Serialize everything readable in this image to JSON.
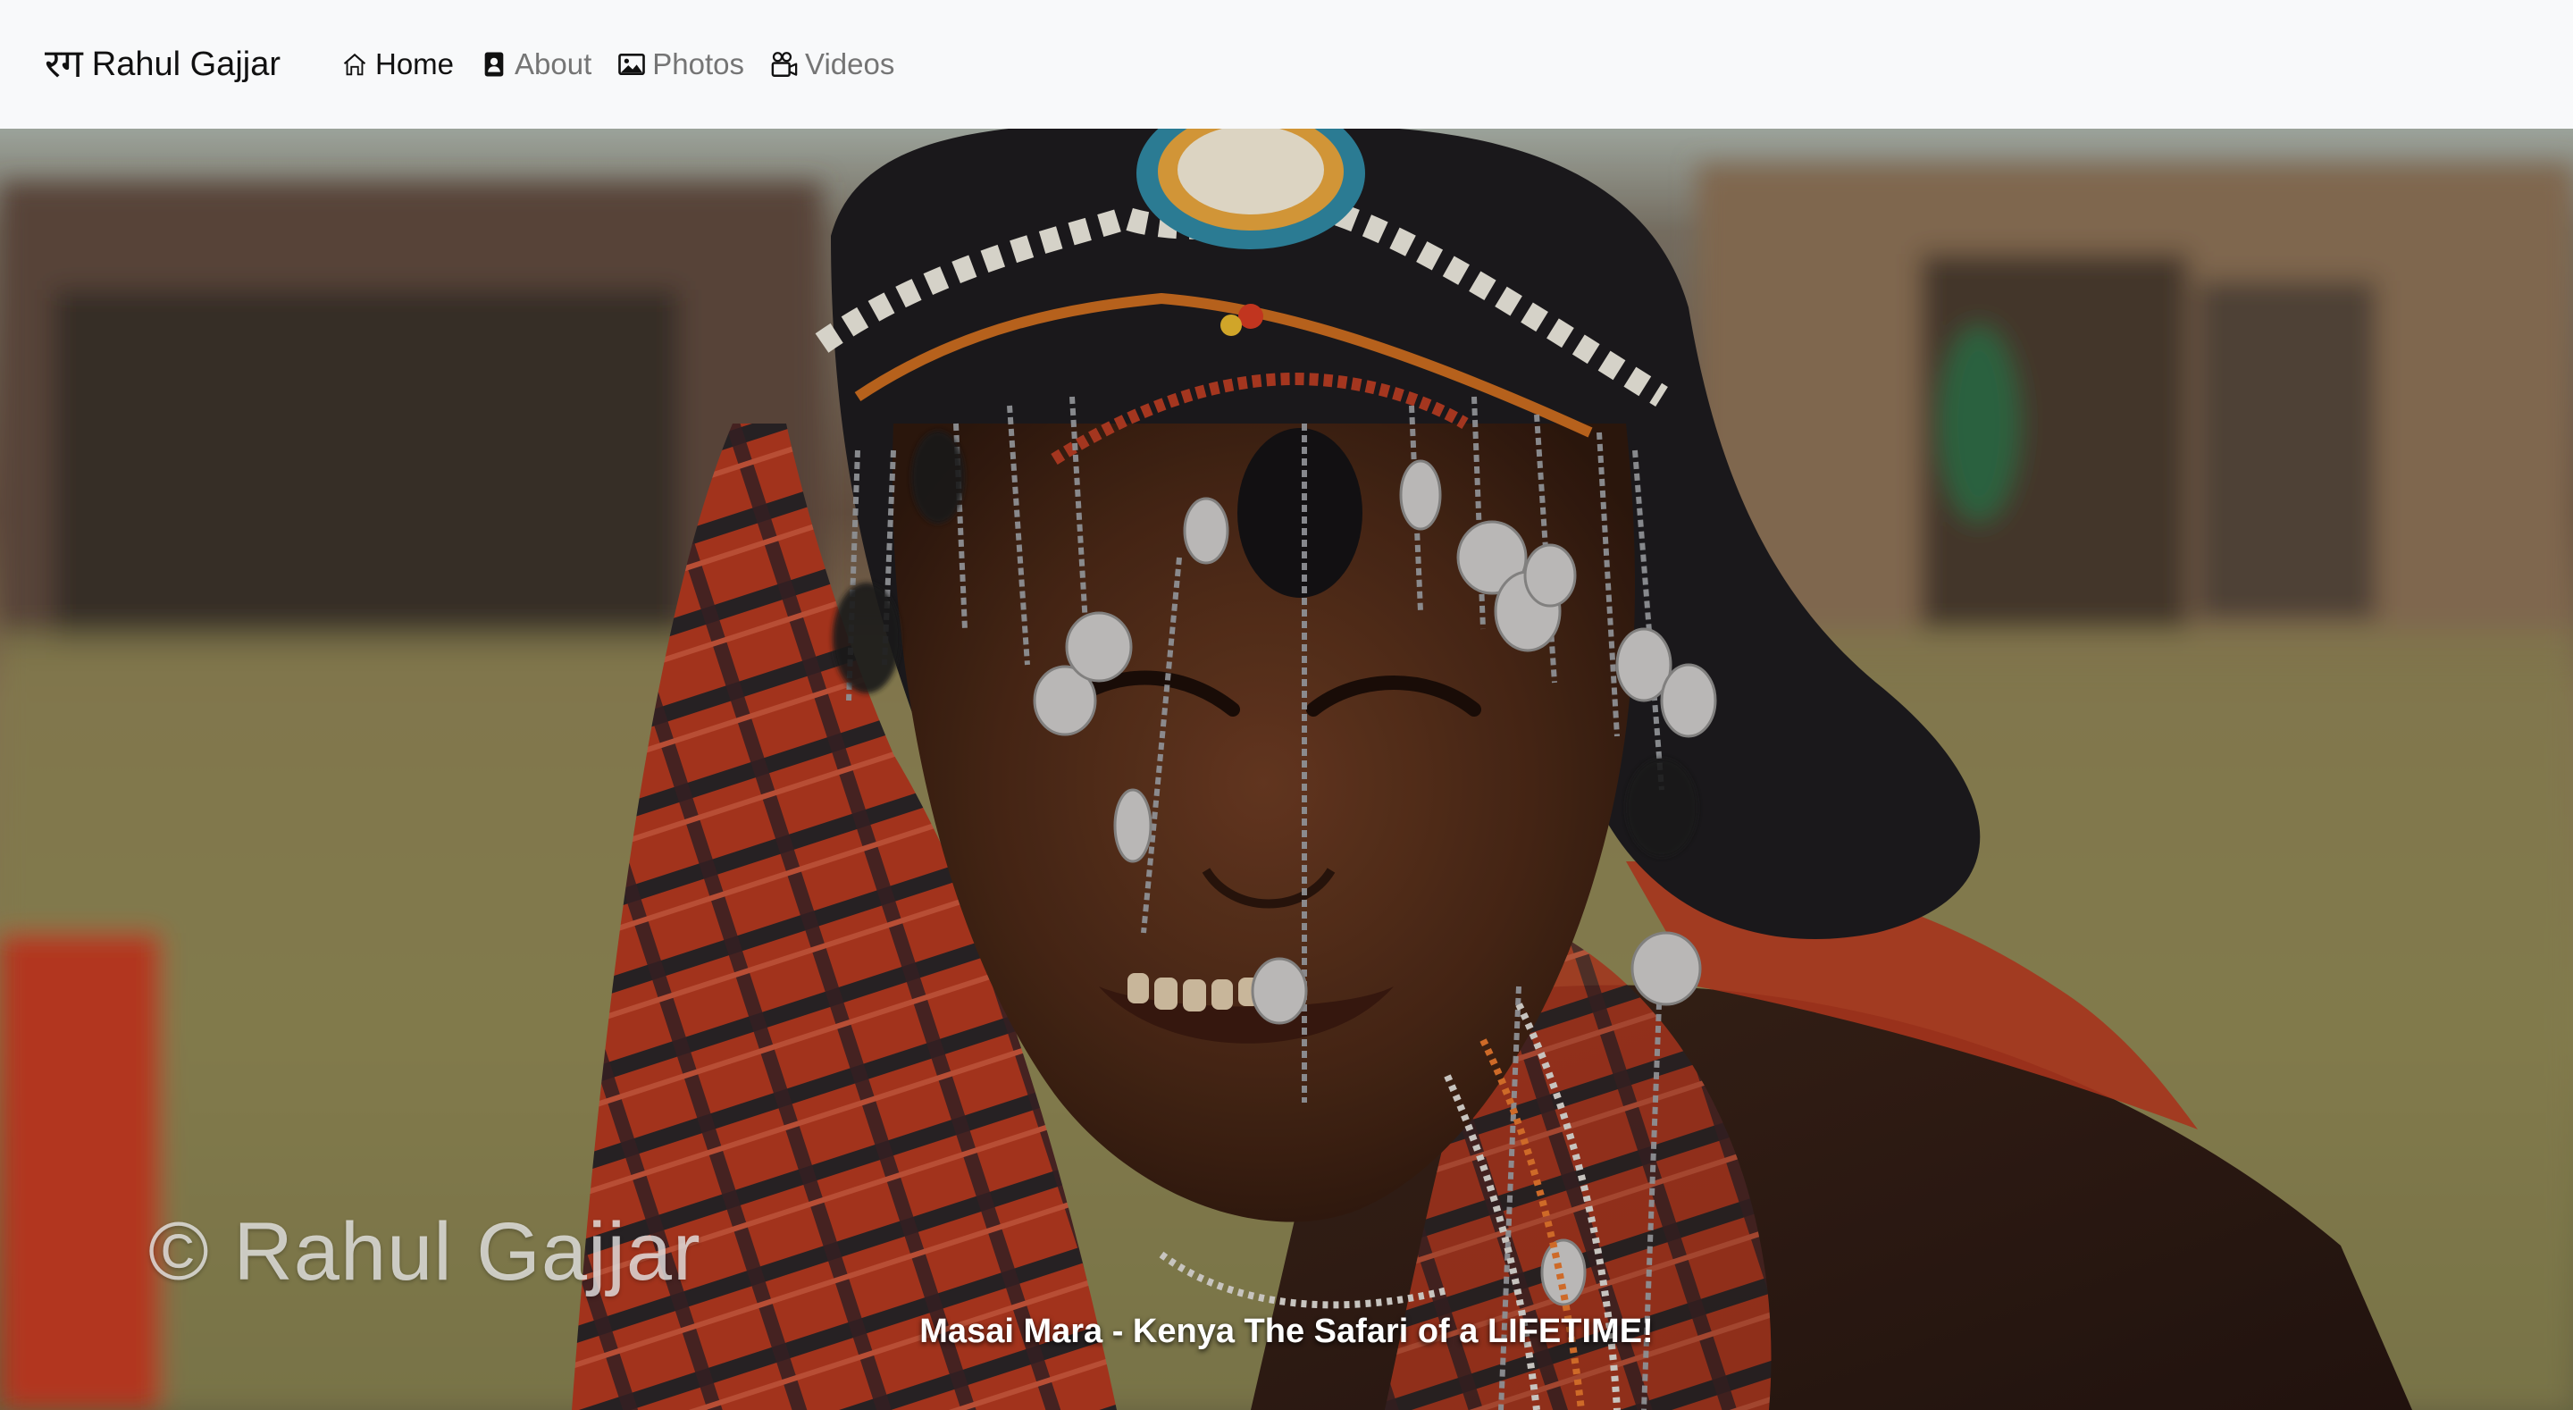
{
  "brand": {
    "mark": "रग",
    "name": "Rahul Gajjar"
  },
  "nav": {
    "items": [
      {
        "label": "Home",
        "icon": "home-icon",
        "active": true
      },
      {
        "label": "About",
        "icon": "contact-card-icon",
        "active": false
      },
      {
        "label": "Photos",
        "icon": "image-icon",
        "active": false
      },
      {
        "label": "Videos",
        "icon": "camera-reels-icon",
        "active": false
      }
    ]
  },
  "hero": {
    "watermark": "© Rahul Gajjar",
    "caption": "Masai Mara - Kenya The Safari of a LIFETIME!"
  },
  "colors": {
    "navbar_bg": "#f8f9fa",
    "nav_active": "#111111",
    "nav_inactive": "#757575"
  }
}
